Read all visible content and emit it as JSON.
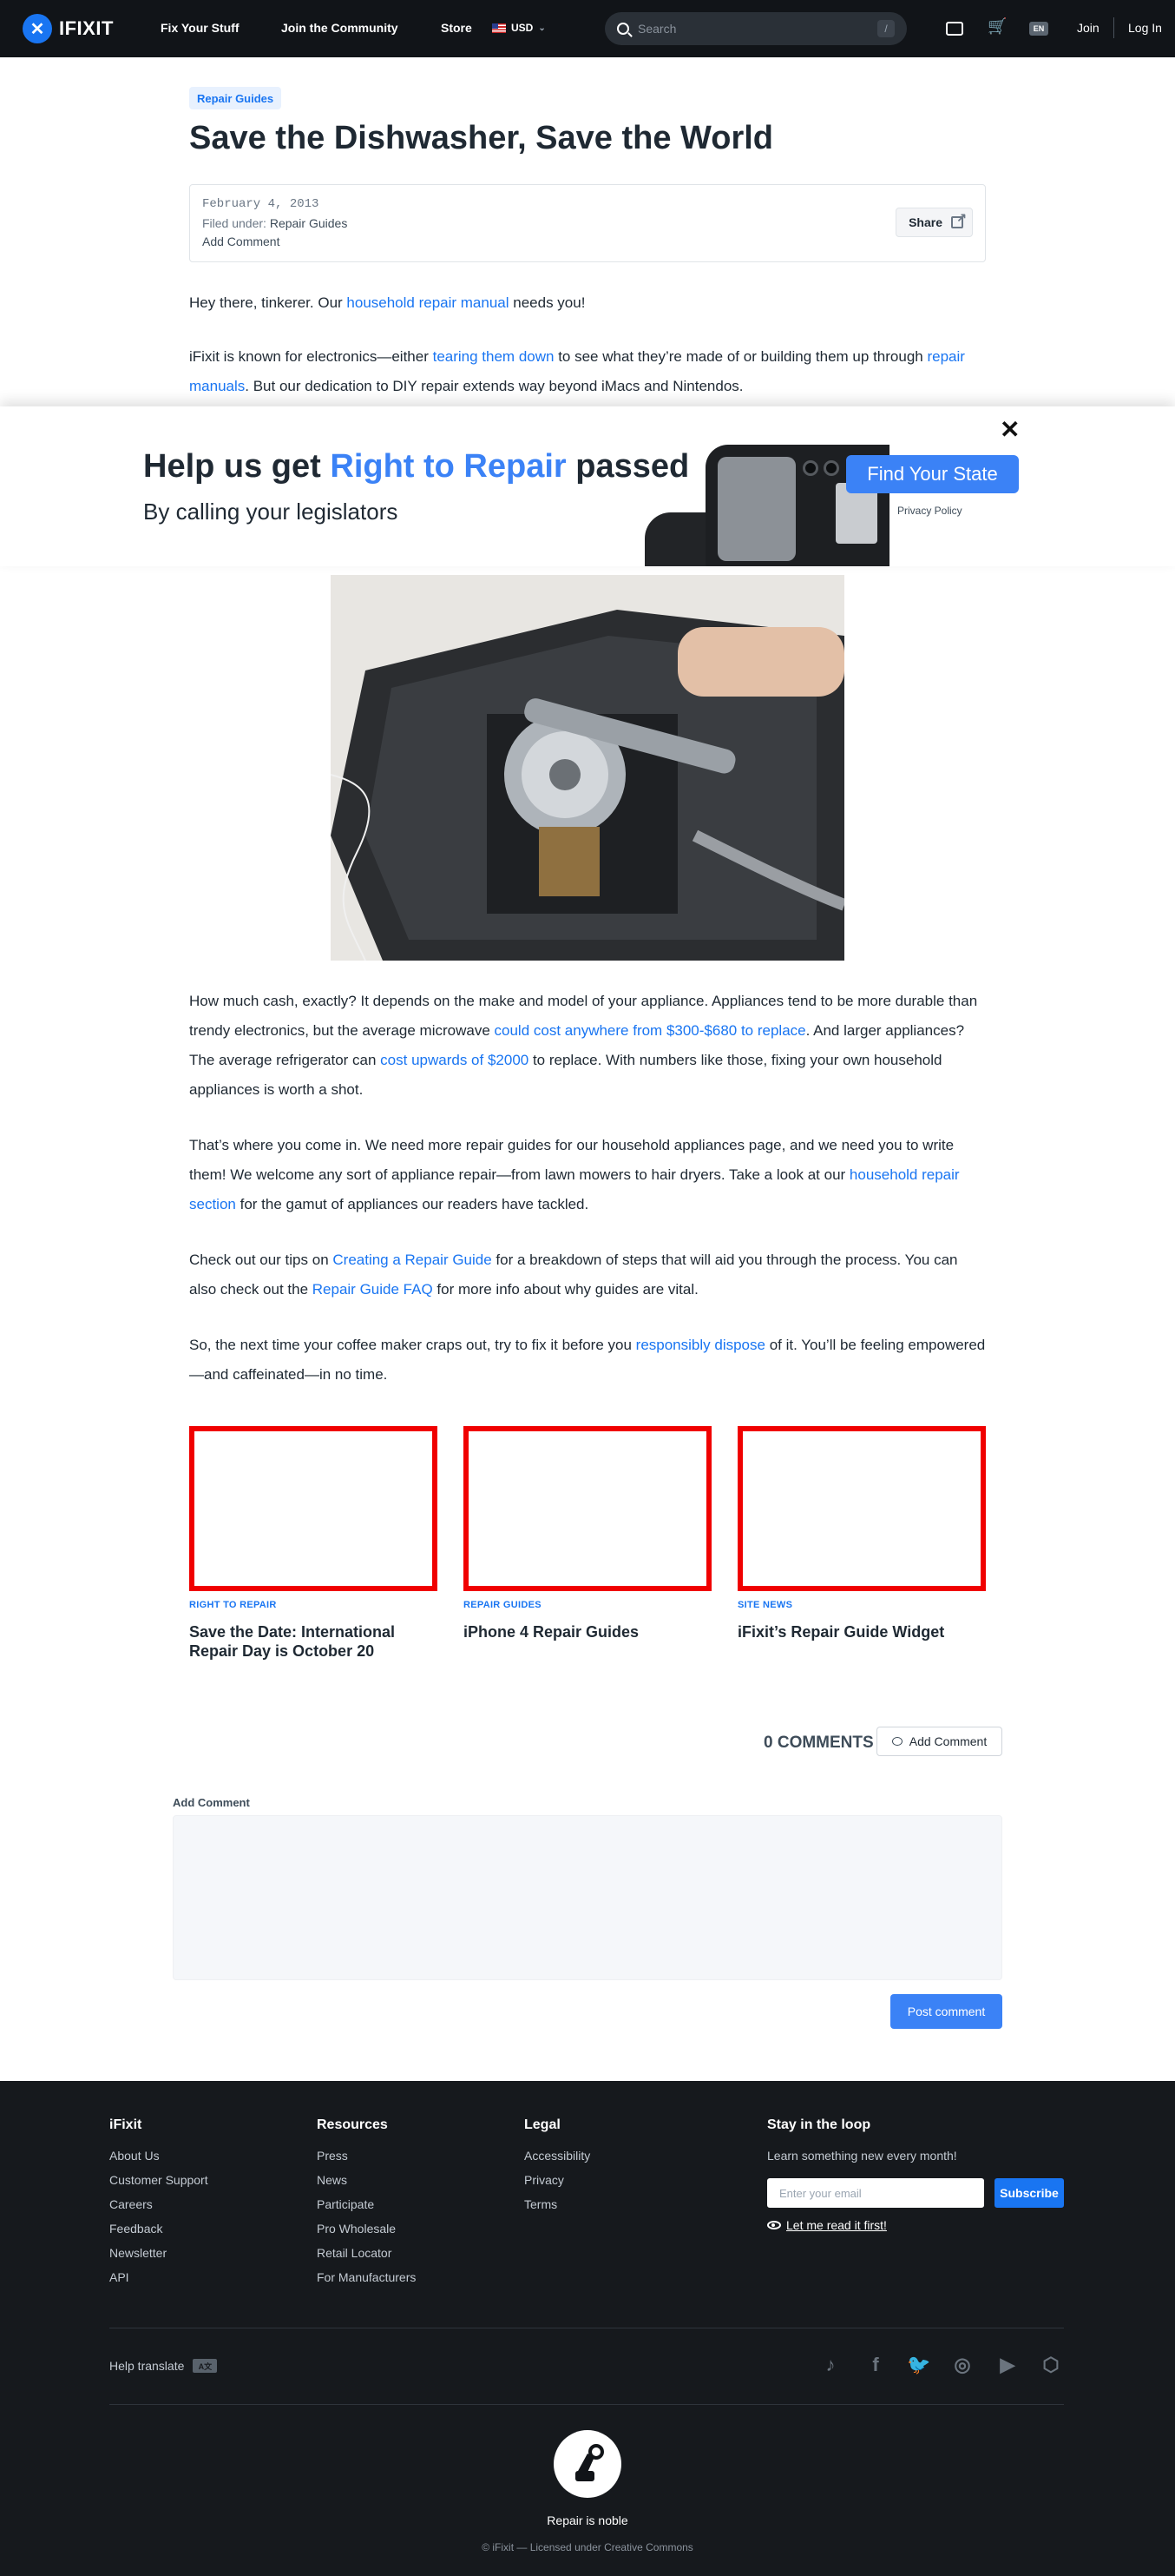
{
  "header": {
    "logo_text": "IFIXIT",
    "nav": [
      "Fix Your Stuff",
      "Join the Community",
      "Store"
    ],
    "currency": "USD",
    "search_placeholder": "Search",
    "search_shortcut": "/",
    "language": "EN",
    "join": "Join",
    "login": "Log In"
  },
  "article": {
    "category": "Repair Guides",
    "title": "Save the Dishwasher, Save the World",
    "date": "February 4, 2013",
    "filed_label": "Filed under: ",
    "filed_value": "Repair Guides",
    "add_comment": "Add Comment",
    "share": "Share",
    "p1": [
      {
        "t": "Hey there, tinkerer. Our "
      },
      {
        "t": "household repair manual",
        "link": true
      },
      {
        "t": " needs you!"
      }
    ],
    "p2": [
      {
        "t": "iFixit is known for electronics—either "
      },
      {
        "t": "tearing them down",
        "link": true
      },
      {
        "t": " to see what they’re made of or building them up through "
      },
      {
        "t": "repair manuals",
        "link": true
      },
      {
        "t": ". But our dedication to DIY repair extends way beyond iMacs and Nintendos."
      }
    ],
    "p3": [
      {
        "t": "How much cash, exactly? It depends on the make and model of your appliance. Appliances tend to be more durable than trendy electronics, but the average microwave "
      },
      {
        "t": "could cost anywhere from $300-$680 to replace",
        "link": true
      },
      {
        "t": ". And larger appliances? The average refrigerator can "
      },
      {
        "t": "cost upwards of $2000",
        "link": true
      },
      {
        "t": " to replace. With numbers like those, fixing your own household appliances is worth a shot."
      }
    ],
    "p4": [
      {
        "t": "That’s where you come in. We need more repair guides for our household appliances page, and we need you to write them! We welcome any sort of appliance repair—from lawn mowers to hair dryers. Take a look at our "
      },
      {
        "t": "household repair section",
        "link": true
      },
      {
        "t": " for the gamut of appliances our readers have tackled."
      }
    ],
    "p5": [
      {
        "t": "Check out our tips on "
      },
      {
        "t": "Creating a Repair Guide",
        "link": true
      },
      {
        "t": " for a breakdown of steps that will aid you through the process. You can also check out the "
      },
      {
        "t": "Repair Guide FAQ",
        "link": true
      },
      {
        "t": " for more info about why guides are vital."
      }
    ],
    "p6": [
      {
        "t": "So, the next time your coffee maker craps out, try to fix it before you "
      },
      {
        "t": "responsibly dispose",
        "link": true
      },
      {
        "t": " of it. You’ll be feeling empowered—and caffeinated—in no time."
      }
    ]
  },
  "r2r": {
    "close": "✕",
    "headline_pre": "Help us get ",
    "headline_accent": "Right to Repair",
    "headline_post": " passed",
    "sub": "By calling your legislators",
    "cta": "Find Your State",
    "privacy": "Privacy Policy"
  },
  "related": [
    {
      "category": "RIGHT TO REPAIR",
      "title": "Save the Date: International Repair Day is October 20"
    },
    {
      "category": "REPAIR GUIDES",
      "title": "iPhone 4 Repair Guides"
    },
    {
      "category": "SITE NEWS",
      "title": "iFixit’s Repair Guide Widget"
    }
  ],
  "comments": {
    "count_label": "0 COMMENTS",
    "add_button": "Add Comment",
    "form_label": "Add Comment",
    "post_button": "Post comment"
  },
  "footer": {
    "columns": [
      {
        "heading": "iFixit",
        "links": [
          "About Us",
          "Customer Support",
          "Careers",
          "Feedback",
          "Newsletter",
          "API"
        ]
      },
      {
        "heading": "Resources",
        "links": [
          "Press",
          "News",
          "Participate",
          "Pro Wholesale",
          "Retail Locator",
          "For Manufacturers"
        ]
      },
      {
        "heading": "Legal",
        "links": [
          "Accessibility",
          "Privacy",
          "Terms"
        ]
      }
    ],
    "newsletter": {
      "heading": "Stay in the loop",
      "desc": "Learn something new every month!",
      "email_placeholder": "Enter your email",
      "subscribe": "Subscribe",
      "read_it": "Let me read it first!"
    },
    "help_translate": "Help translate",
    "social": [
      "tiktok-icon",
      "facebook-icon",
      "twitter-icon",
      "instagram-icon",
      "youtube-icon",
      "hexagon-icon"
    ],
    "tagline": "Repair is noble",
    "copyright": "© iFixit — Licensed under Creative Commons"
  },
  "colors": {
    "brand_blue": "#1975f2",
    "cta_blue": "#3b82f6",
    "header_bg": "#111418",
    "footer_bg": "#16191d",
    "placeholder_frame": "#f00000"
  }
}
